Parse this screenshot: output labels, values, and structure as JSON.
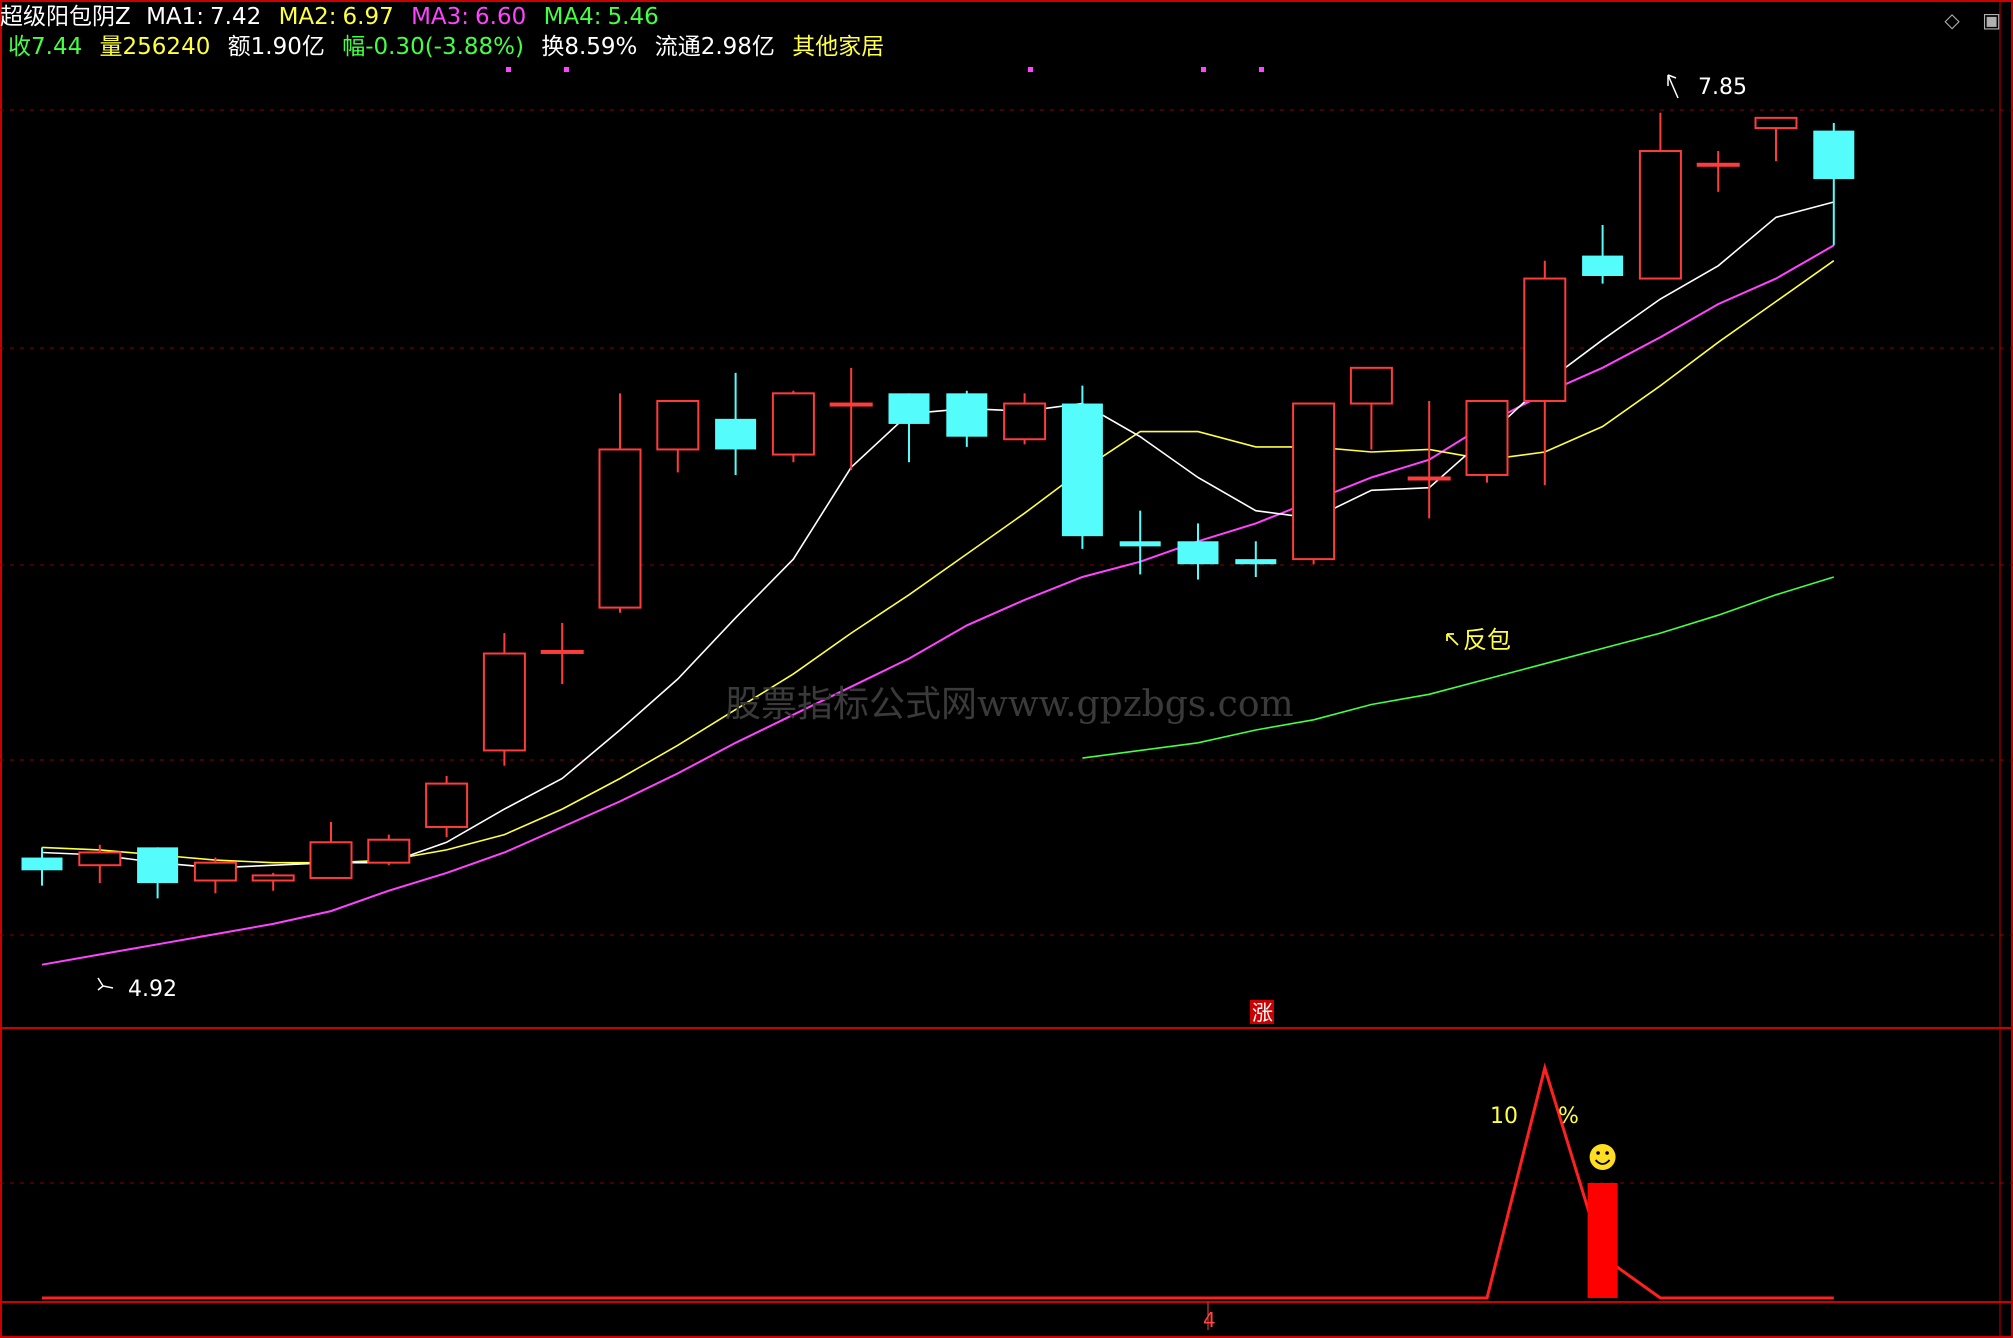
{
  "header": {
    "indicator_name": "超级阳包阴Z",
    "ma": [
      {
        "label": "MA1:",
        "value": "7.42",
        "color": "#ffffff"
      },
      {
        "label": "MA2:",
        "value": "6.97",
        "color": "#ffff44"
      },
      {
        "label": "MA3:",
        "value": "6.60",
        "color": "#ff44ff"
      },
      {
        "label": "MA4:",
        "value": "5.46",
        "color": "#44ff44"
      }
    ],
    "close_label": "收",
    "close_value": "7.44",
    "volume_label": "量",
    "volume_value": "256240",
    "amount_label": "额",
    "amount_value": "1.90亿",
    "change_label": "幅",
    "change_value": "-0.30(-3.88%)",
    "turnover_label": "换",
    "turnover_value": "8.59%",
    "float_label": "流通",
    "float_value": "2.98亿",
    "sector": "其他家居"
  },
  "annotations": {
    "high_label": "7.85",
    "low_label": "4.92",
    "signal_label": "反包",
    "zhang_label": "涨",
    "pct_number": "10",
    "pct_sign": "%",
    "axis_tick": "4"
  },
  "watermark": "股票指标公式网www.gpzbgs.com",
  "icons": [
    "diamond-icon",
    "window-icon"
  ],
  "colors": {
    "up": "#ff3b3b",
    "down": "#54fcfc",
    "ma1": "#ffffff",
    "ma2": "#ffff44",
    "ma3": "#ff44ff",
    "ma4": "#44ff44",
    "grid": "#8b0000",
    "text_yellow": "#ffff44"
  },
  "chart_data": {
    "type": "candlestick",
    "price_range": [
      4.6,
      8.05
    ],
    "candles": [
      {
        "o": 5.08,
        "h": 5.12,
        "l": 4.97,
        "c": 5.03
      },
      {
        "o": 5.05,
        "h": 5.13,
        "l": 4.98,
        "c": 5.1
      },
      {
        "o": 5.12,
        "h": 5.12,
        "l": 4.92,
        "c": 4.98
      },
      {
        "o": 4.99,
        "h": 5.08,
        "l": 4.94,
        "c": 5.06
      },
      {
        "o": 4.99,
        "h": 5.02,
        "l": 4.95,
        "c": 5.01
      },
      {
        "o": 5.0,
        "h": 5.22,
        "l": 5.0,
        "c": 5.14
      },
      {
        "o": 5.06,
        "h": 5.17,
        "l": 5.05,
        "c": 5.15
      },
      {
        "o": 5.2,
        "h": 5.4,
        "l": 5.16,
        "c": 5.37
      },
      {
        "o": 5.5,
        "h": 5.96,
        "l": 5.44,
        "c": 5.88
      },
      {
        "o": 5.89,
        "h": 6.0,
        "l": 5.76,
        "c": 5.89
      },
      {
        "o": 6.06,
        "h": 6.9,
        "l": 6.04,
        "c": 6.68
      },
      {
        "o": 6.68,
        "h": 6.86,
        "l": 6.59,
        "c": 6.87
      },
      {
        "o": 6.8,
        "h": 6.98,
        "l": 6.58,
        "c": 6.68
      },
      {
        "o": 6.66,
        "h": 6.91,
        "l": 6.63,
        "c": 6.9
      },
      {
        "o": 6.86,
        "h": 7.0,
        "l": 6.6,
        "c": 6.86
      },
      {
        "o": 6.9,
        "h": 6.9,
        "l": 6.63,
        "c": 6.78
      },
      {
        "o": 6.9,
        "h": 6.91,
        "l": 6.69,
        "c": 6.73
      },
      {
        "o": 6.72,
        "h": 6.9,
        "l": 6.7,
        "c": 6.86
      },
      {
        "o": 6.86,
        "h": 6.93,
        "l": 6.29,
        "c": 6.34
      },
      {
        "o": 6.32,
        "h": 6.44,
        "l": 6.19,
        "c": 6.3
      },
      {
        "o": 6.32,
        "h": 6.39,
        "l": 6.17,
        "c": 6.23
      },
      {
        "o": 6.25,
        "h": 6.32,
        "l": 6.18,
        "c": 6.23
      },
      {
        "o": 6.25,
        "h": 6.86,
        "l": 6.23,
        "c": 6.86
      },
      {
        "o": 6.86,
        "h": 7.0,
        "l": 6.68,
        "c": 7.0
      },
      {
        "o": 6.57,
        "h": 6.87,
        "l": 6.41,
        "c": 6.57
      },
      {
        "o": 6.58,
        "h": 6.87,
        "l": 6.55,
        "c": 6.87
      },
      {
        "o": 6.87,
        "h": 7.42,
        "l": 6.54,
        "c": 7.35
      },
      {
        "o": 7.44,
        "h": 7.56,
        "l": 7.33,
        "c": 7.36
      },
      {
        "o": 7.35,
        "h": 8.0,
        "l": 7.35,
        "c": 7.85
      },
      {
        "o": 7.8,
        "h": 7.85,
        "l": 7.69,
        "c": 7.8
      },
      {
        "o": 7.94,
        "h": 7.98,
        "l": 7.81,
        "c": 7.98
      },
      {
        "o": 7.93,
        "h": 7.96,
        "l": 7.48,
        "c": 7.74
      }
    ],
    "ma1": [
      5.1,
      5.09,
      5.06,
      5.04,
      5.05,
      5.06,
      5.06,
      5.14,
      5.27,
      5.39,
      5.58,
      5.78,
      6.02,
      6.25,
      6.61,
      6.82,
      6.84,
      6.83,
      6.86,
      6.73,
      6.57,
      6.44,
      6.41,
      6.52,
      6.53,
      6.73,
      6.94,
      7.11,
      7.27,
      7.4,
      7.59,
      7.65
    ],
    "ma2": [
      5.12,
      5.11,
      5.09,
      5.07,
      5.06,
      5.06,
      5.07,
      5.11,
      5.17,
      5.27,
      5.39,
      5.52,
      5.66,
      5.8,
      5.96,
      6.11,
      6.27,
      6.43,
      6.6,
      6.75,
      6.75,
      6.69,
      6.69,
      6.67,
      6.68,
      6.64,
      6.67,
      6.77,
      6.93,
      7.1,
      7.26,
      7.42
    ],
    "ma3": [
      4.66,
      4.7,
      4.74,
      4.78,
      4.82,
      4.87,
      4.95,
      5.02,
      5.1,
      5.2,
      5.3,
      5.41,
      5.53,
      5.64,
      5.75,
      5.86,
      5.99,
      6.09,
      6.18,
      6.24,
      6.32,
      6.39,
      6.48,
      6.57,
      6.64,
      6.78,
      6.9,
      7.0,
      7.12,
      7.25,
      7.35,
      7.48
    ],
    "ma4": [
      5.47,
      5.5,
      5.53,
      5.58,
      5.62,
      5.68,
      5.72,
      5.78,
      5.84,
      5.9,
      5.96,
      6.03,
      6.11,
      6.18
    ],
    "ma4_start_index": 18,
    "indicator": {
      "range": [
        0,
        100
      ],
      "line": [
        0,
        0,
        0,
        0,
        0,
        0,
        0,
        0,
        0,
        0,
        0,
        0,
        0,
        0,
        0,
        0,
        0,
        0,
        0,
        0,
        0,
        0,
        0,
        0,
        0,
        0,
        100,
        18,
        0,
        0,
        0,
        0
      ],
      "bar_index": 27,
      "bar_value": 50
    }
  }
}
